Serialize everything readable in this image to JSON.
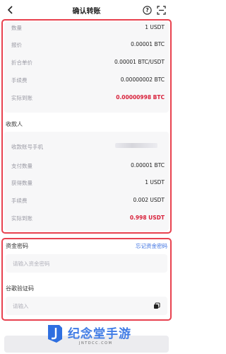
{
  "header": {
    "title": "确认转账"
  },
  "summary": {
    "rows": [
      {
        "label": "数量",
        "value": "1 USDT"
      },
      {
        "label": "报价",
        "value": "0.00001 BTC"
      },
      {
        "label": "折合单价",
        "value": "0.00001 BTC/USDT"
      },
      {
        "label": "手续费",
        "value": "0.00000002 BTC"
      },
      {
        "label": "实际到账",
        "value": "0.00000998 BTC"
      }
    ]
  },
  "payee": {
    "title": "收款人",
    "rows": [
      {
        "label": "收款账号手机",
        "value": ""
      },
      {
        "label": "支付数量",
        "value": "0.00001 BTC"
      },
      {
        "label": "获得数量",
        "value": "1 USDT"
      },
      {
        "label": "手续费",
        "value": "0.002 USDT"
      },
      {
        "label": "实际到账",
        "value": "0.998 USDT"
      }
    ]
  },
  "fund_password": {
    "label": "资金密码",
    "forgot_link": "忘记资金密码",
    "placeholder": "请输入资金密码"
  },
  "google_code": {
    "label": "谷歌验证码",
    "placeholder": "请输入"
  },
  "watermark": {
    "text": "纪念堂手游",
    "url": "JNTDCC.COM"
  },
  "colors": {
    "accent_red": "#e8424f",
    "value_red": "#d8203a",
    "link_blue": "#3a6fe0"
  },
  "icons": [
    "back-icon",
    "help-icon",
    "scan-icon",
    "paste-icon"
  ]
}
